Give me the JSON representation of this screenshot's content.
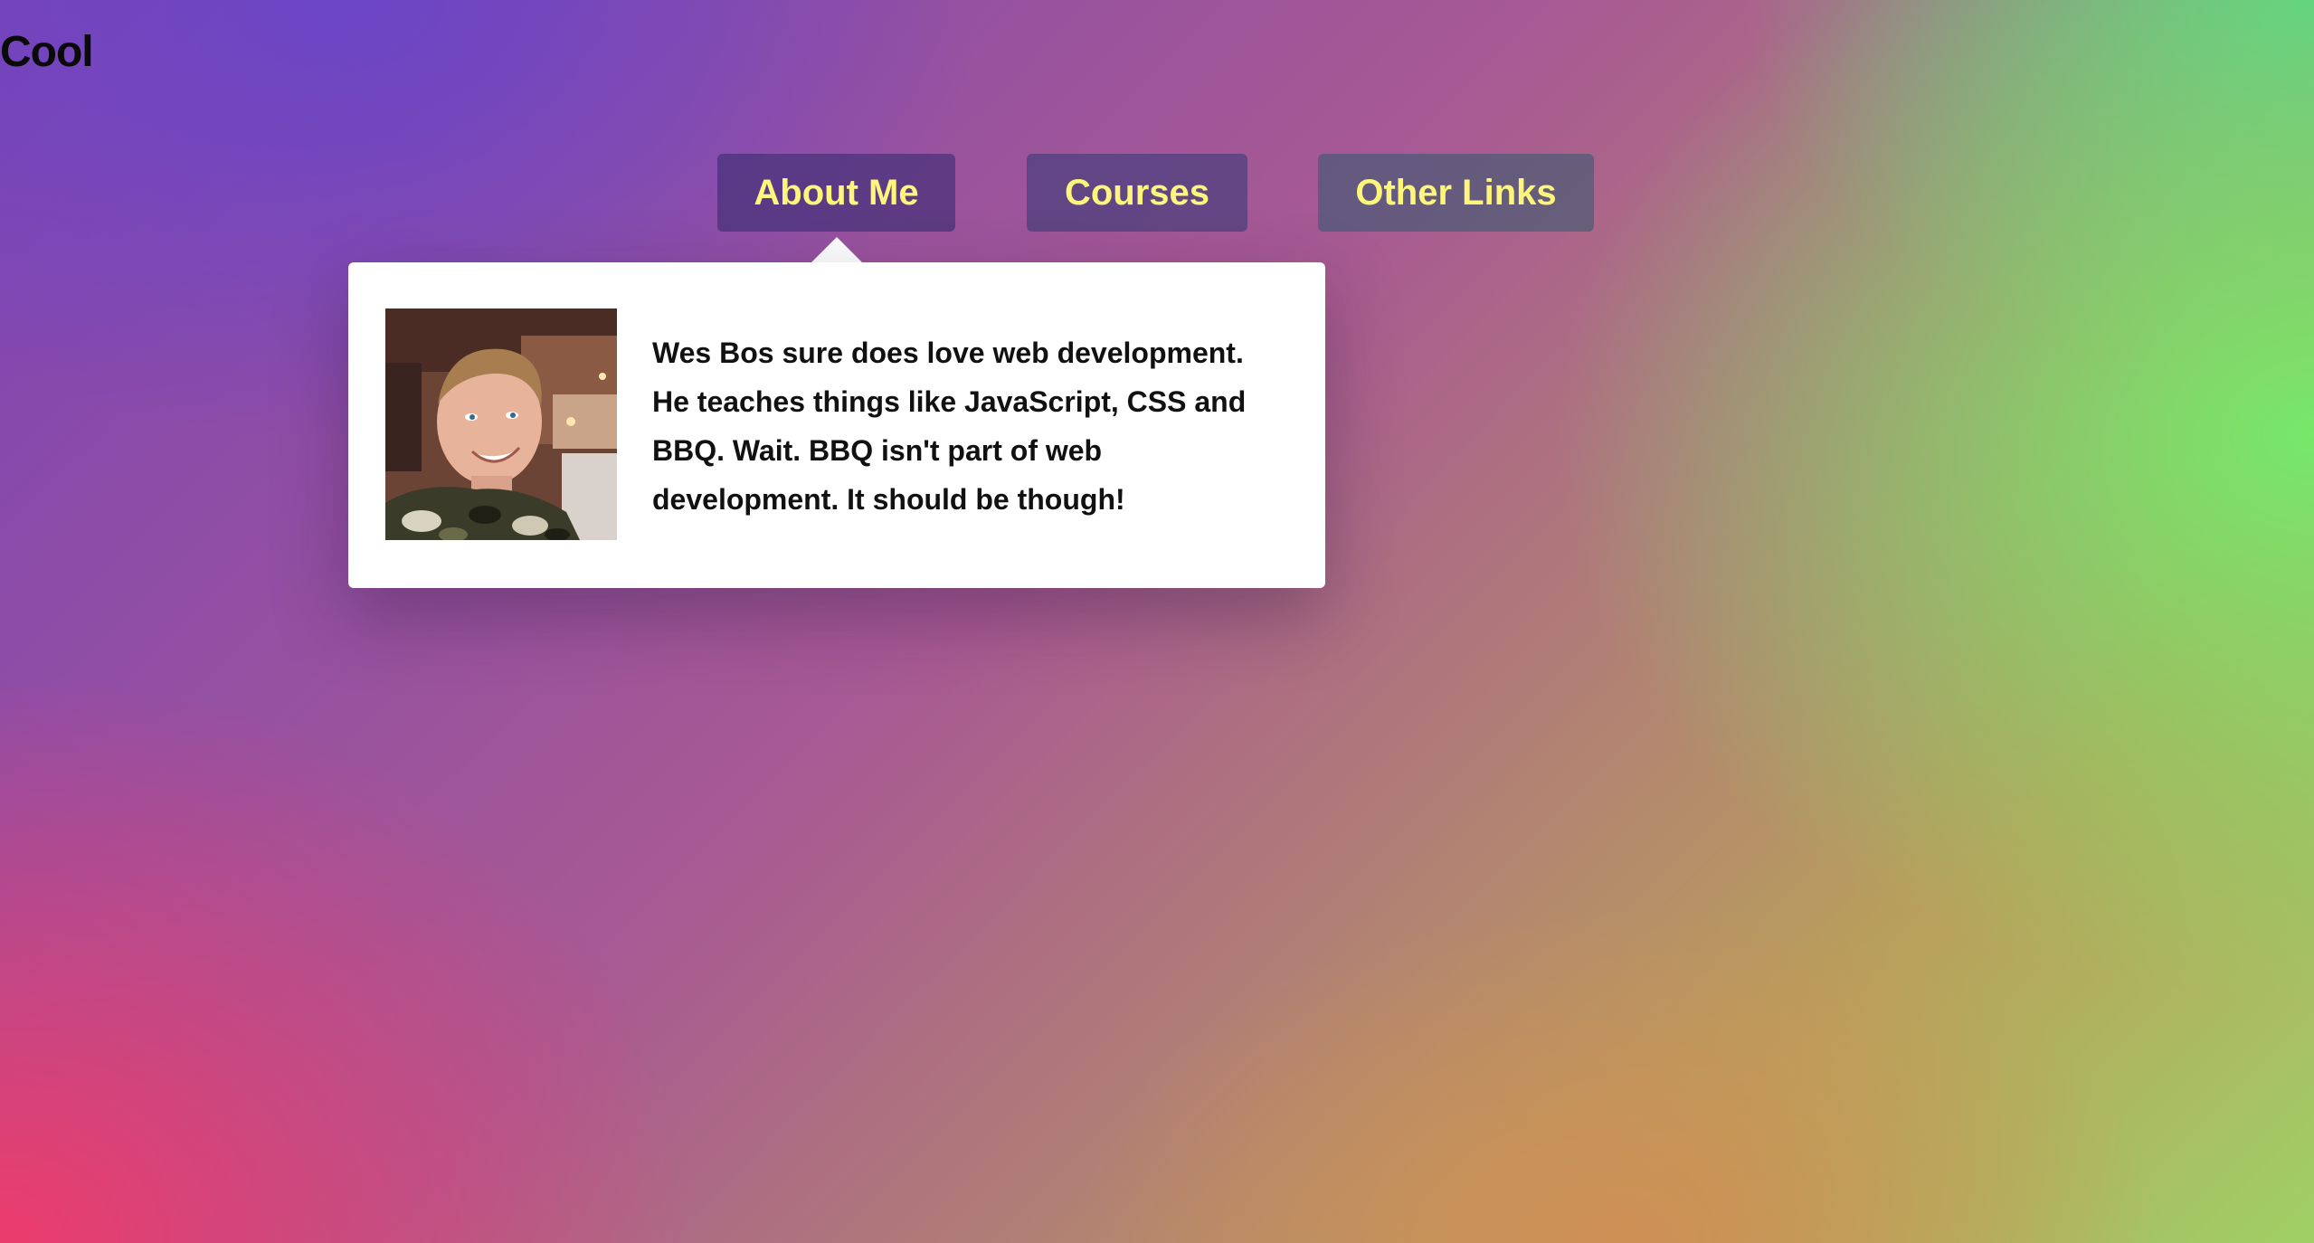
{
  "header": {
    "title": "Cool"
  },
  "nav": {
    "items": [
      {
        "label": "About Me"
      },
      {
        "label": "Courses"
      },
      {
        "label": "Other Links"
      }
    ]
  },
  "dropdown": {
    "avatar_icon": "person-photo",
    "bio": "Wes Bos sure does love web development. He teaches things like JavaScript, CSS and BBQ. Wait. BBQ isn't part of web development. It should be though!"
  },
  "colors": {
    "nav_text": "#fdf67a",
    "dropdown_bg": "#ffffff",
    "title_text": "#0a0a0a"
  }
}
